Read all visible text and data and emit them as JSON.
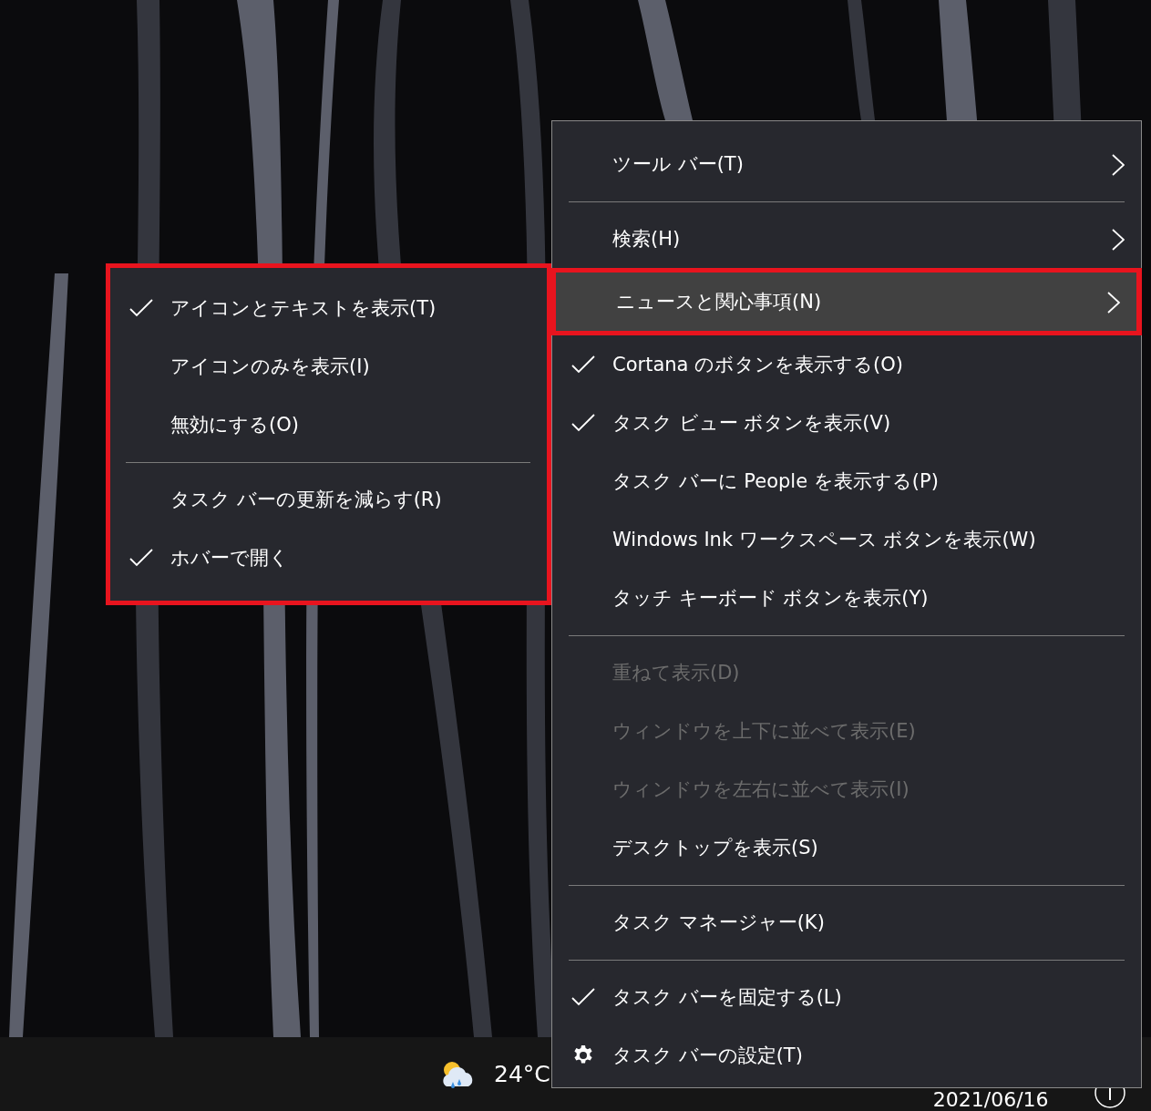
{
  "context_menu": {
    "items": [
      {
        "kind": "submenu",
        "label": "ツール バー(T)",
        "checked": false,
        "disabled": false,
        "selected": false
      },
      {
        "kind": "separator"
      },
      {
        "kind": "submenu",
        "label": "検索(H)",
        "checked": false,
        "disabled": false,
        "selected": false
      },
      {
        "kind": "submenu",
        "label": "ニュースと関心事項(N)",
        "checked": false,
        "disabled": false,
        "selected": true
      },
      {
        "kind": "command",
        "label": "Cortana のボタンを表示する(O)",
        "checked": true,
        "disabled": false,
        "selected": false
      },
      {
        "kind": "command",
        "label": "タスク ビュー ボタンを表示(V)",
        "checked": true,
        "disabled": false,
        "selected": false
      },
      {
        "kind": "command",
        "label": "タスク バーに People を表示する(P)",
        "checked": false,
        "disabled": false,
        "selected": false
      },
      {
        "kind": "command",
        "label": "Windows Ink ワークスペース ボタンを表示(W)",
        "checked": false,
        "disabled": false,
        "selected": false
      },
      {
        "kind": "command",
        "label": "タッチ キーボード ボタンを表示(Y)",
        "checked": false,
        "disabled": false,
        "selected": false
      },
      {
        "kind": "separator"
      },
      {
        "kind": "command",
        "label": "重ねて表示(D)",
        "checked": false,
        "disabled": true,
        "selected": false
      },
      {
        "kind": "command",
        "label": "ウィンドウを上下に並べて表示(E)",
        "checked": false,
        "disabled": true,
        "selected": false
      },
      {
        "kind": "command",
        "label": "ウィンドウを左右に並べて表示(I)",
        "checked": false,
        "disabled": true,
        "selected": false
      },
      {
        "kind": "command",
        "label": "デスクトップを表示(S)",
        "checked": false,
        "disabled": false,
        "selected": false
      },
      {
        "kind": "separator"
      },
      {
        "kind": "command",
        "label": "タスク マネージャー(K)",
        "checked": false,
        "disabled": false,
        "selected": false
      },
      {
        "kind": "separator"
      },
      {
        "kind": "command",
        "label": "タスク バーを固定する(L)",
        "checked": true,
        "disabled": false,
        "selected": false
      },
      {
        "kind": "gear",
        "label": "タスク バーの設定(T)",
        "checked": false,
        "disabled": false,
        "selected": false
      }
    ]
  },
  "news_submenu": {
    "items": [
      {
        "kind": "command",
        "label": "アイコンとテキストを表示(T)",
        "checked": true,
        "disabled": false,
        "selected": false
      },
      {
        "kind": "command",
        "label": "アイコンのみを表示(I)",
        "checked": false,
        "disabled": false,
        "selected": false
      },
      {
        "kind": "command",
        "label": "無効にする(O)",
        "checked": false,
        "disabled": false,
        "selected": false
      },
      {
        "kind": "separator"
      },
      {
        "kind": "command",
        "label": "タスク バーの更新を減らす(R)",
        "checked": false,
        "disabled": false,
        "selected": false
      },
      {
        "kind": "command",
        "label": "ホバーで開く",
        "checked": true,
        "disabled": false,
        "selected": false
      }
    ]
  },
  "taskbar": {
    "temperature": "24°C",
    "date": "2021/06/16"
  }
}
